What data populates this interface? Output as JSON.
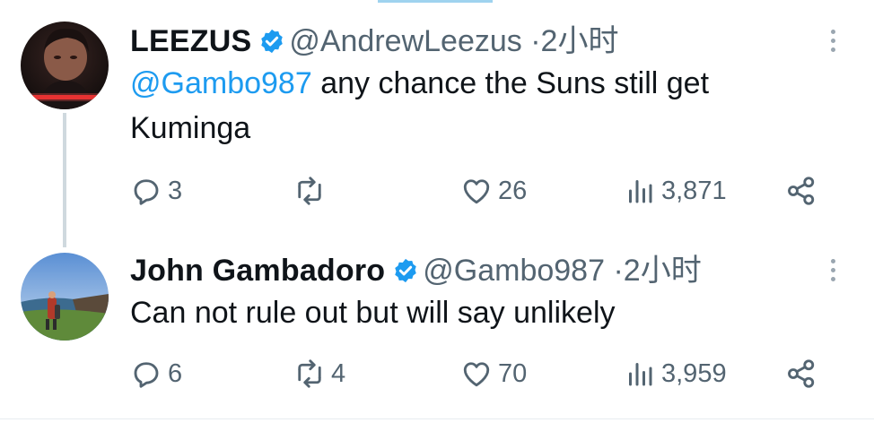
{
  "tweets": [
    {
      "name": "LEEZUS",
      "handle": "@AndrewLeezus",
      "dot": "·",
      "time": "2小时",
      "mention": "@Gambo987",
      "text": " any chance the Suns still get Kuminga",
      "reply_count": "3",
      "retweet_count": "",
      "like_count": "26",
      "view_count": "3,871"
    },
    {
      "name": "John Gambadoro",
      "handle": "@Gambo987",
      "dot": "·",
      "time": "2小时",
      "mention": "",
      "text": "Can not rule out but will say unlikely",
      "reply_count": "6",
      "retweet_count": "4",
      "like_count": "70",
      "view_count": "3,959"
    }
  ],
  "icons": {
    "verified": "verified-badge-icon",
    "reply": "reply-icon",
    "retweet": "retweet-icon",
    "like": "heart-icon",
    "views": "views-icon",
    "share": "share-icon",
    "more": "more-icon"
  },
  "colors": {
    "accent": "#1d9bf0",
    "text": "#0f1419",
    "secondary": "#536471",
    "line": "#cfd9de"
  }
}
